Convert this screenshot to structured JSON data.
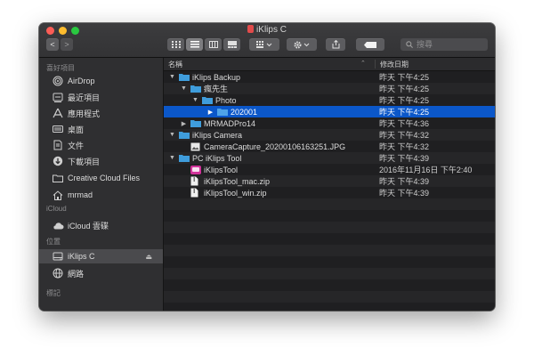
{
  "window": {
    "title": "iKlips C"
  },
  "toolbar": {
    "nav_back": "<",
    "nav_forward": ">",
    "search_placeholder": "搜尋"
  },
  "sidebar": {
    "sections": [
      {
        "header": "喜好項目",
        "items": [
          {
            "label": "AirDrop",
            "icon": "airdrop-icon"
          },
          {
            "label": "最近項目",
            "icon": "recents-icon"
          },
          {
            "label": "應用程式",
            "icon": "applications-icon"
          },
          {
            "label": "桌面",
            "icon": "desktop-icon"
          },
          {
            "label": "文件",
            "icon": "documents-icon"
          },
          {
            "label": "下載項目",
            "icon": "downloads-icon"
          },
          {
            "label": "Creative Cloud Files",
            "icon": "folder-icon"
          },
          {
            "label": "mrmad",
            "icon": "home-icon"
          }
        ]
      },
      {
        "header": "iCloud",
        "items": [
          {
            "label": "iCloud 雲碟",
            "icon": "cloud-icon"
          }
        ]
      },
      {
        "header": "位置",
        "items": [
          {
            "label": "iKlips C",
            "icon": "drive-icon",
            "selected": true,
            "eject": "⏏"
          },
          {
            "label": "網路",
            "icon": "network-icon"
          }
        ]
      },
      {
        "header": "標記",
        "items": []
      }
    ]
  },
  "columns": {
    "name": "名稱",
    "date": "修改日期",
    "sort_indicator": "⌃"
  },
  "files": [
    {
      "name": "iKlips Backup",
      "date": "昨天 下午4:25",
      "indent": 0,
      "disclosure": "▼",
      "kind": "folder"
    },
    {
      "name": "瘋先生",
      "date": "昨天 下午4:25",
      "indent": 1,
      "disclosure": "▼",
      "kind": "folder"
    },
    {
      "name": "Photo",
      "date": "昨天 下午4:25",
      "indent": 2,
      "disclosure": "▼",
      "kind": "folder"
    },
    {
      "name": "202001",
      "date": "昨天 下午4:25",
      "indent": 3,
      "disclosure": "▶",
      "kind": "folder",
      "selected": true
    },
    {
      "name": "MRMADPro14",
      "date": "昨天 下午4:36",
      "indent": 1,
      "disclosure": "▶",
      "kind": "folder"
    },
    {
      "name": "iKlips Camera",
      "date": "昨天 下午4:32",
      "indent": 0,
      "disclosure": "▼",
      "kind": "folder"
    },
    {
      "name": "CameraCapture_20200106163251.JPG",
      "date": "昨天 下午4:32",
      "indent": 1,
      "disclosure": "",
      "kind": "image"
    },
    {
      "name": "PC iKlips Tool",
      "date": "昨天 下午4:39",
      "indent": 0,
      "disclosure": "▼",
      "kind": "folder"
    },
    {
      "name": "iKlipsTool",
      "date": "2016年11月16日 下午2:40",
      "indent": 1,
      "disclosure": "",
      "kind": "app"
    },
    {
      "name": "iKlipsTool_mac.zip",
      "date": "昨天 下午4:39",
      "indent": 1,
      "disclosure": "",
      "kind": "document"
    },
    {
      "name": "iKlipsTool_win.zip",
      "date": "昨天 下午4:39",
      "indent": 1,
      "disclosure": "",
      "kind": "document"
    }
  ],
  "colors": {
    "selection": "#0b57c9",
    "folder": "#3f9ddc",
    "sidebar_bg": "#2f2f31",
    "content_bg": "#1f1f21"
  }
}
